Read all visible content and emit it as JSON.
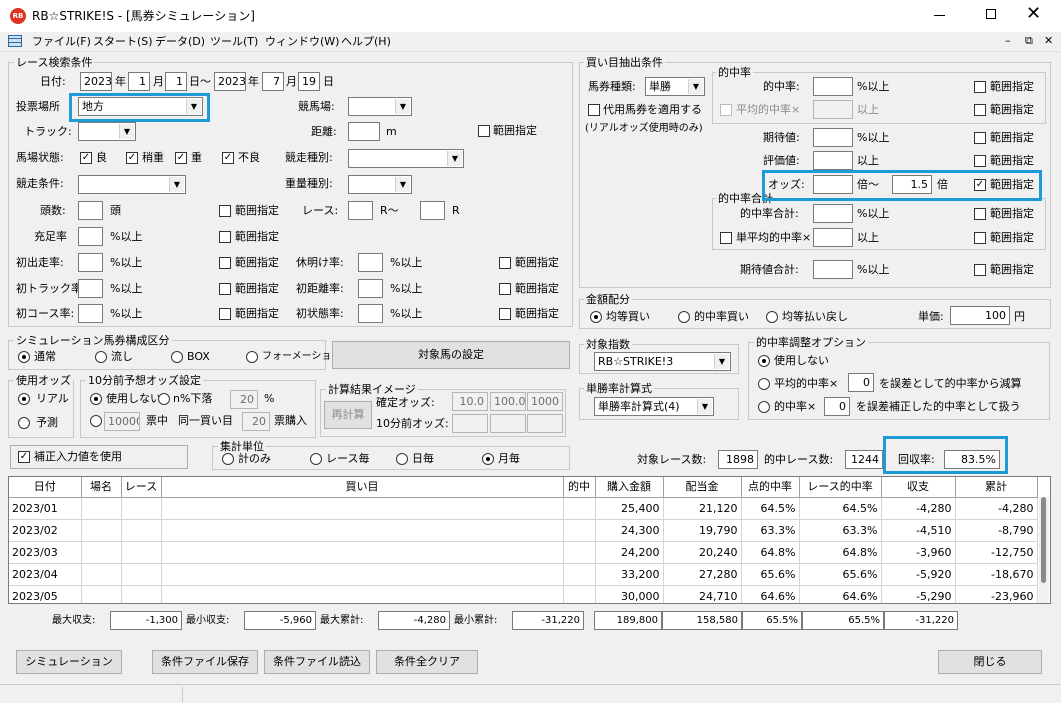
{
  "window": {
    "title": "RB☆STRIKE!S - [馬券シミュレーション]",
    "app_icon": "rb-logo-icon"
  },
  "menu": [
    "ファイル(F)",
    "スタート(S)",
    "データ(D)",
    "ツール(T)",
    "ウィンドウ(W)",
    "ヘルプ(H)"
  ],
  "race": {
    "group_title": "レース検索条件",
    "date_label": "日付:",
    "from_year": "2023",
    "year_sfx": "年",
    "from_month": "1",
    "month_sfx": "月",
    "from_day": "1",
    "day_sfx": "日〜",
    "to_year": "2023",
    "to_month": "7",
    "to_day": "19",
    "to_day_sfx": "日",
    "venue_label": "投票場所",
    "venue_value": "地方",
    "course_label": "競馬場:",
    "course_value": "",
    "track_label": "トラック:",
    "track_value": "",
    "distance_label": "距離:",
    "distance_value": "",
    "distance_unit": "m",
    "range_label": "範囲指定",
    "condition_label": "馬場状態:",
    "cond_good": "良",
    "cond_slight": "稍重",
    "cond_heavy": "重",
    "cond_bad": "不良",
    "race_type_label": "競走種別:",
    "race_type_value": "",
    "race_cond_label": "競走条件:",
    "race_cond_value": "",
    "weight_type_label": "重量種別:",
    "weight_type_value": "",
    "heads_label": "頭数:",
    "heads_value": "",
    "heads_unit": "頭",
    "race_no_label": "レース:",
    "race_no_from": "",
    "race_no_mid": "R〜",
    "race_no_to": "",
    "race_no_unit": "R",
    "fill_label": "充足率",
    "pct_over": "%以上",
    "first_run_label": "初出走率:",
    "rest_label": "休明け率:",
    "first_track_label": "初トラック率:",
    "first_dist_label": "初距離率:",
    "first_course_label": "初コース率:",
    "first_state_label": "初状態率:"
  },
  "sim": {
    "group_title": "シミュレーション馬券構成区分",
    "options": [
      "通常",
      "流し",
      "BOX",
      "フォーメーション"
    ],
    "target_button": "対象馬の設定"
  },
  "odds_use": {
    "group_title": "使用オッズ",
    "options": [
      "リアル",
      "予測"
    ]
  },
  "pre10": {
    "group_title": "10分前予想オッズ設定",
    "opt_none": "使用しない",
    "opt_drop": "n%下落",
    "drop_value": "20",
    "drop_unit": "%",
    "amount": "10000",
    "mid": "票中",
    "same": "同一買い目",
    "count": "20",
    "buy": "票購入"
  },
  "calc": {
    "group_title": "計算結果イメージ",
    "recalc": "再計算",
    "confirmed_label": "確定オッズ:",
    "c1": "10.0",
    "c2": "100.0",
    "c3": "1000",
    "pre10_label": "10分前オッズ:"
  },
  "correction": {
    "label": "補正入力値を使用"
  },
  "agg": {
    "group_title": "集計単位",
    "options": [
      "計のみ",
      "レース毎",
      "日毎",
      "月毎"
    ]
  },
  "buy": {
    "group_title": "買い目抽出条件",
    "ticket_label": "馬券種類:",
    "ticket_value": "単勝",
    "substitute_label": "代用馬券を適用する",
    "substitute_note": "(リアルオッズ使用時のみ)",
    "hit_group": "的中率",
    "hit_rate_label": "的中率:",
    "pct_over": "%以上",
    "pct_under": "以上",
    "avg_hit_label": "平均的中率×",
    "expect_label": "期待値:",
    "eval_label": "評価値:",
    "eval_sfx": "以上",
    "odds_label": "オッズ:",
    "odds_from": "",
    "odds_mid": "倍〜",
    "odds_to": "1.5",
    "odds_unit": "倍",
    "hit_total_group": "的中率合計",
    "hit_total_label": "的中率合計:",
    "single_avg_label": "単平均的中率×",
    "single_avg_sfx": "以上",
    "expect_total_label": "期待値合計:",
    "range_label": "範囲指定"
  },
  "money": {
    "group_title": "金額配分",
    "options": [
      "均等買い",
      "的中率買い",
      "均等払い戻し"
    ],
    "unit_label": "単価:",
    "unit_value": "100",
    "unit_sfx": "円"
  },
  "index": {
    "group_title": "対象指数",
    "value": "RB☆STRIKE!3"
  },
  "tansho": {
    "group_title": "単勝率計算式",
    "value": "単勝率計算式(4)"
  },
  "adjust": {
    "group_title": "的中率調整オプション",
    "opt_none": "使用しない",
    "opt_avg": "平均的中率×",
    "avg_value": "0",
    "avg_text": "を誤差として的中率から減算",
    "opt_hit": "的中率×",
    "hit_value": "0",
    "hit_text": "を誤差補正した的中率として扱う"
  },
  "stats": {
    "races_label": "対象レース数:",
    "races": "1898",
    "hit_races_label": "的中レース数:",
    "hit_races": "1244",
    "return_label": "回収率:",
    "return_rate": "83.5%"
  },
  "table": {
    "headers": [
      "日付",
      "場名",
      "レース",
      "買い目",
      "的中",
      "購入金額",
      "配当金",
      "点的中率",
      "レース的中率",
      "収支",
      "累計"
    ],
    "rows": [
      [
        "2023/01",
        "",
        "",
        "",
        "",
        "25,400",
        "21,120",
        "64.5%",
        "64.5%",
        "-4,280",
        "-4,280"
      ],
      [
        "2023/02",
        "",
        "",
        "",
        "",
        "24,300",
        "19,790",
        "63.3%",
        "63.3%",
        "-4,510",
        "-8,790"
      ],
      [
        "2023/03",
        "",
        "",
        "",
        "",
        "24,200",
        "20,240",
        "64.8%",
        "64.8%",
        "-3,960",
        "-12,750"
      ],
      [
        "2023/04",
        "",
        "",
        "",
        "",
        "33,200",
        "27,280",
        "65.6%",
        "65.6%",
        "-5,920",
        "-18,670"
      ],
      [
        "2023/05",
        "",
        "",
        "",
        "",
        "30,000",
        "24,710",
        "64.6%",
        "64.6%",
        "-5,290",
        "-23,960"
      ]
    ]
  },
  "summary": {
    "max_pl_label": "最大収支:",
    "max_pl": "-1,300",
    "min_pl_label": "最小収支:",
    "min_pl": "-5,960",
    "max_cum_label": "最大累計:",
    "max_cum": "-4,280",
    "min_cum_label": "最小累計:",
    "min_cum": "-31,220",
    "total_buy": "189,800",
    "total_pay": "158,580",
    "total_point": "65.5%",
    "total_race": "65.5%",
    "total_pl": "-31,220"
  },
  "buttons": {
    "simulate": "シミュレーション",
    "save": "条件ファイル保存",
    "load": "条件ファイル読込",
    "clear": "条件全クリア",
    "close": "閉じる"
  }
}
